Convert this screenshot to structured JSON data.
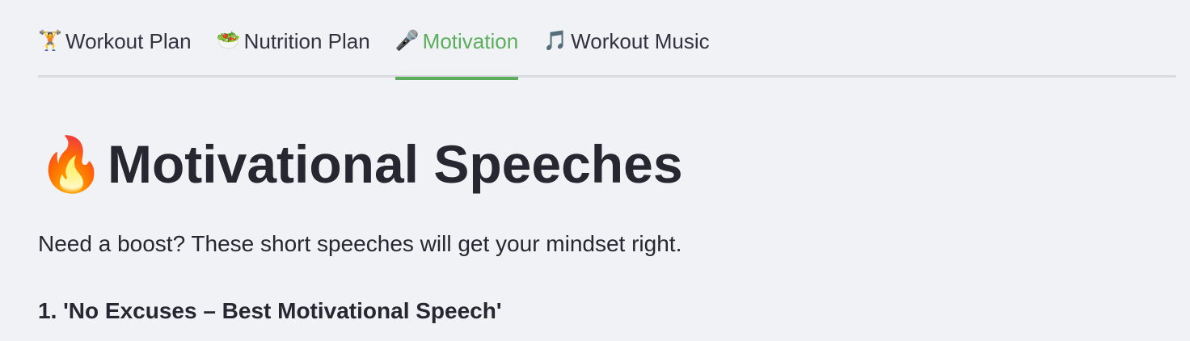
{
  "tabs": [
    {
      "icon": "🏋️",
      "icon_name": "weightlifter-icon",
      "label": "Workout Plan",
      "active": false
    },
    {
      "icon": "🥗",
      "icon_name": "salad-icon",
      "label": "Nutrition Plan",
      "active": false
    },
    {
      "icon": "🎤",
      "icon_name": "microphone-icon",
      "label": "Motivation",
      "active": true
    },
    {
      "icon": "🎵",
      "icon_name": "music-note-icon",
      "label": "Workout Music",
      "active": false
    }
  ],
  "page": {
    "title_icon": "🔥",
    "title_icon_name": "fire-icon",
    "title": "Motivational Speeches",
    "description": "Need a boost? These short speeches will get your mindset right.",
    "items": [
      {
        "label": "1. 'No Excuses – Best Motivational Speech'"
      }
    ]
  },
  "colors": {
    "accent": "#5cad5c",
    "background": "#f0f2f6",
    "text": "#262730",
    "tab_border": "#d9dbe0"
  }
}
